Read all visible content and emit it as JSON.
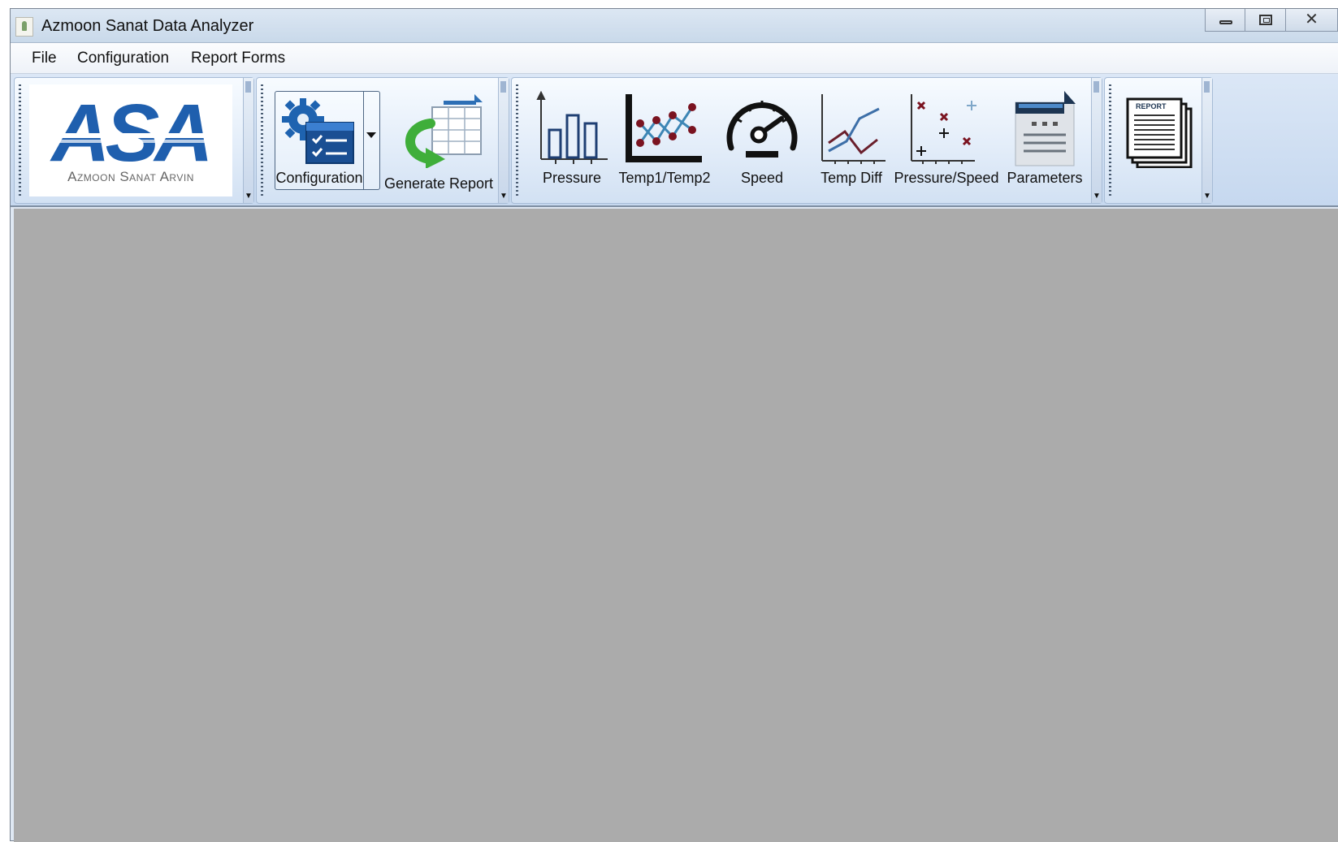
{
  "window": {
    "title": "Azmoon Sanat Data Analyzer"
  },
  "menu": {
    "items": [
      "File",
      "Configuration",
      "Report Forms"
    ]
  },
  "logo": {
    "text": "ASA",
    "caption": "Azmoon Sanat Arvin"
  },
  "toolbar": {
    "configuration_label": "Configuration",
    "generate_report_label": "Generate Report",
    "charts": [
      {
        "label": "Pressure",
        "icon": "bar-chart-icon"
      },
      {
        "label": "Temp1/Temp2",
        "icon": "line-chart-icon"
      },
      {
        "label": "Speed",
        "icon": "speedometer-icon"
      },
      {
        "label": "Temp Diff",
        "icon": "cross-lines-chart-icon"
      },
      {
        "label": "Pressure/Speed",
        "icon": "scatter-chart-icon"
      },
      {
        "label": "Parameters",
        "icon": "document-list-icon"
      }
    ],
    "report_icon_text": "REPORT"
  },
  "colors": {
    "accent_blue": "#1f5fae",
    "mdi_background": "#ababab",
    "green_arrow": "#3fae3a"
  }
}
